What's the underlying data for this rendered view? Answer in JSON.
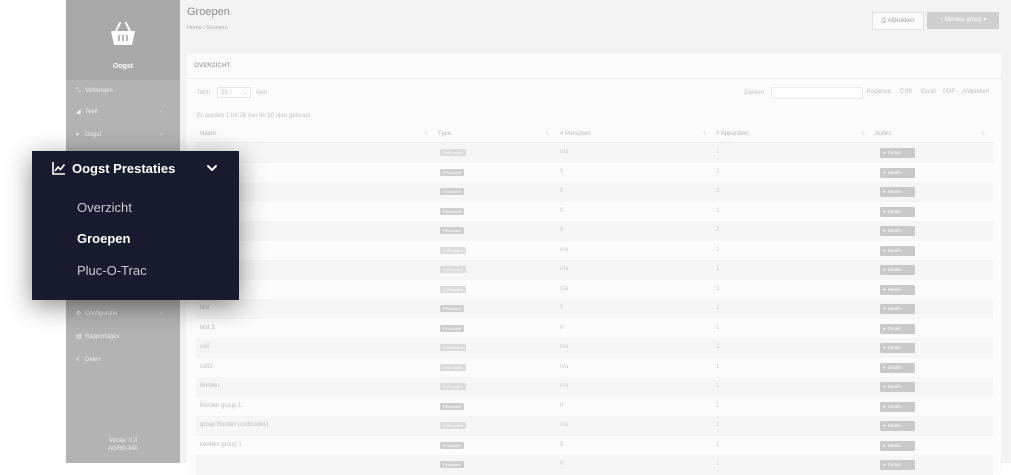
{
  "sidebar": {
    "brand": "Oogst",
    "items": [
      {
        "icon": "compress-icon",
        "label": "Verbergen",
        "has_chevron": false
      },
      {
        "icon": "chart-icon",
        "label": "Teelt",
        "has_chevron": true
      },
      {
        "icon": "basket-icon",
        "label": "Oogst",
        "has_chevron": true
      },
      {
        "icon": "gear-icon",
        "label": "Configuratie",
        "has_chevron": true
      },
      {
        "icon": "document-icon",
        "label": "Rapportages",
        "has_chevron": false
      },
      {
        "icon": "share-icon",
        "label": "Delen",
        "has_chevron": false
      }
    ],
    "version_line1": "Versie: 0.3",
    "version_line2": "AGRO-340"
  },
  "header": {
    "title": "Groepen",
    "breadcrumb": [
      "Home",
      "Groepen"
    ],
    "print_label": "Afdrukken",
    "new_label": "+ Nieuwe groep ▾"
  },
  "panel": {
    "title": "OVERZICHT",
    "show_label": "Toon",
    "page_size": "25",
    "show_suffix": "rijen",
    "search_label": "Zoeken:",
    "search_value": "",
    "export_buttons": [
      "Kopieren",
      "CSV",
      "Excel",
      "PDF",
      "Afdrukken"
    ],
    "row_count_text": "Er worden 1 tot 25 van de 50 rijen getoond"
  },
  "table": {
    "columns": [
      "Naam",
      "Type",
      "# Personen",
      "# Apparaten",
      "Acties"
    ],
    "detail_label": "Details",
    "rows": [
      {
        "name": "",
        "type": "Colli codes",
        "personen": "n/a",
        "apparaten": "1"
      },
      {
        "name": "",
        "type": "Personeel",
        "personen": "0",
        "apparaten": "2"
      },
      {
        "name": "",
        "type": "Personeel",
        "personen": "0",
        "apparaten": "2"
      },
      {
        "name": "",
        "type": "Personeel",
        "personen": "0",
        "apparaten": "1"
      },
      {
        "name": "",
        "type": "Personeel",
        "personen": "6",
        "apparaten": "2"
      },
      {
        "name": "",
        "type": "Colli codes",
        "personen": "n/a",
        "apparaten": "1"
      },
      {
        "name": "",
        "type": "Colli codes",
        "personen": "n/a",
        "apparaten": "1"
      },
      {
        "name": "",
        "type": "Colli codes",
        "personen": "n/a",
        "apparaten": "1"
      },
      {
        "name": "test",
        "type": "Personeel",
        "personen": "0",
        "apparaten": "1"
      },
      {
        "name": "test 2",
        "type": "Personeel",
        "personen": "0",
        "apparaten": "1"
      },
      {
        "name": "coli",
        "type": "Colli codes",
        "personen": "n/a",
        "apparaten": "1"
      },
      {
        "name": "coli2",
        "type": "Colli codes",
        "personen": "n/a",
        "apparaten": "1"
      },
      {
        "name": "Borden",
        "type": "Colli codes",
        "personen": "n/a",
        "apparaten": "1"
      },
      {
        "name": "Borden group 1",
        "type": "Personeel",
        "personen": "0",
        "apparaten": "1"
      },
      {
        "name": "group Borden (collicodes)",
        "type": "Colli codes",
        "personen": "n/a",
        "apparaten": "1"
      },
      {
        "name": "kennen group 1",
        "type": "Personeel",
        "personen": "0",
        "apparaten": "1"
      },
      {
        "name": "",
        "type": "Personeel",
        "personen": "0",
        "apparaten": "1"
      }
    ]
  },
  "popup": {
    "title": "Oogst Prestaties",
    "items": [
      {
        "label": "Overzicht",
        "active": false
      },
      {
        "label": "Groepen",
        "active": true
      },
      {
        "label": "Pluc-O-Trac",
        "active": false
      }
    ]
  },
  "colors": {
    "popup_bg": "#161c2d",
    "sidebar_bg": "#b3b3b3",
    "main_bg": "#f3f3f3"
  }
}
